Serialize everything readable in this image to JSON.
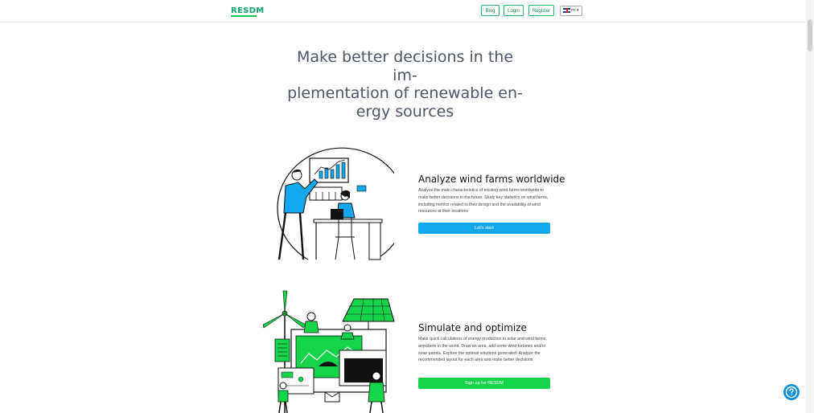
{
  "header": {
    "logo": "RESDM",
    "nav": {
      "blog": "Blog",
      "login": "Login",
      "register": "Register"
    },
    "language": "en ▾"
  },
  "hero": {
    "title": "Make better decisions in the im-plementation of renewable en-ergy sources",
    "lines": [
      "Make better decisions in the im-",
      "plementation of renewable en-",
      "ergy sources"
    ]
  },
  "sections": [
    {
      "title": "Analyze wind farms worldwide",
      "description": "Analyze the main characteristics of existing wind farms worldwide to make better decisions in the future. Study key statistics on wind farms, including metrics related to their design and the availability of wind resources at their locations",
      "button": "Let's start"
    },
    {
      "title": "Simulate and optimize",
      "description": "Make quick calculations of energy production in solar and wind farms anywhere in the world. Draw an area, add some wind turbines and/or solar panels. Explore the optimal solutions generated. Analyze the recommended layout for each area and make better decisions",
      "button": "Sign up for RESDM"
    }
  ],
  "colors": {
    "brand": "#16c957",
    "primary_button": "#13a7ec",
    "secondary_button": "#16d44a",
    "hero_text": "#4c5566",
    "help_button": "#0d8ed9"
  },
  "icons": {
    "help": "question-circle-icon",
    "language_flag": "uk-flag-icon"
  }
}
